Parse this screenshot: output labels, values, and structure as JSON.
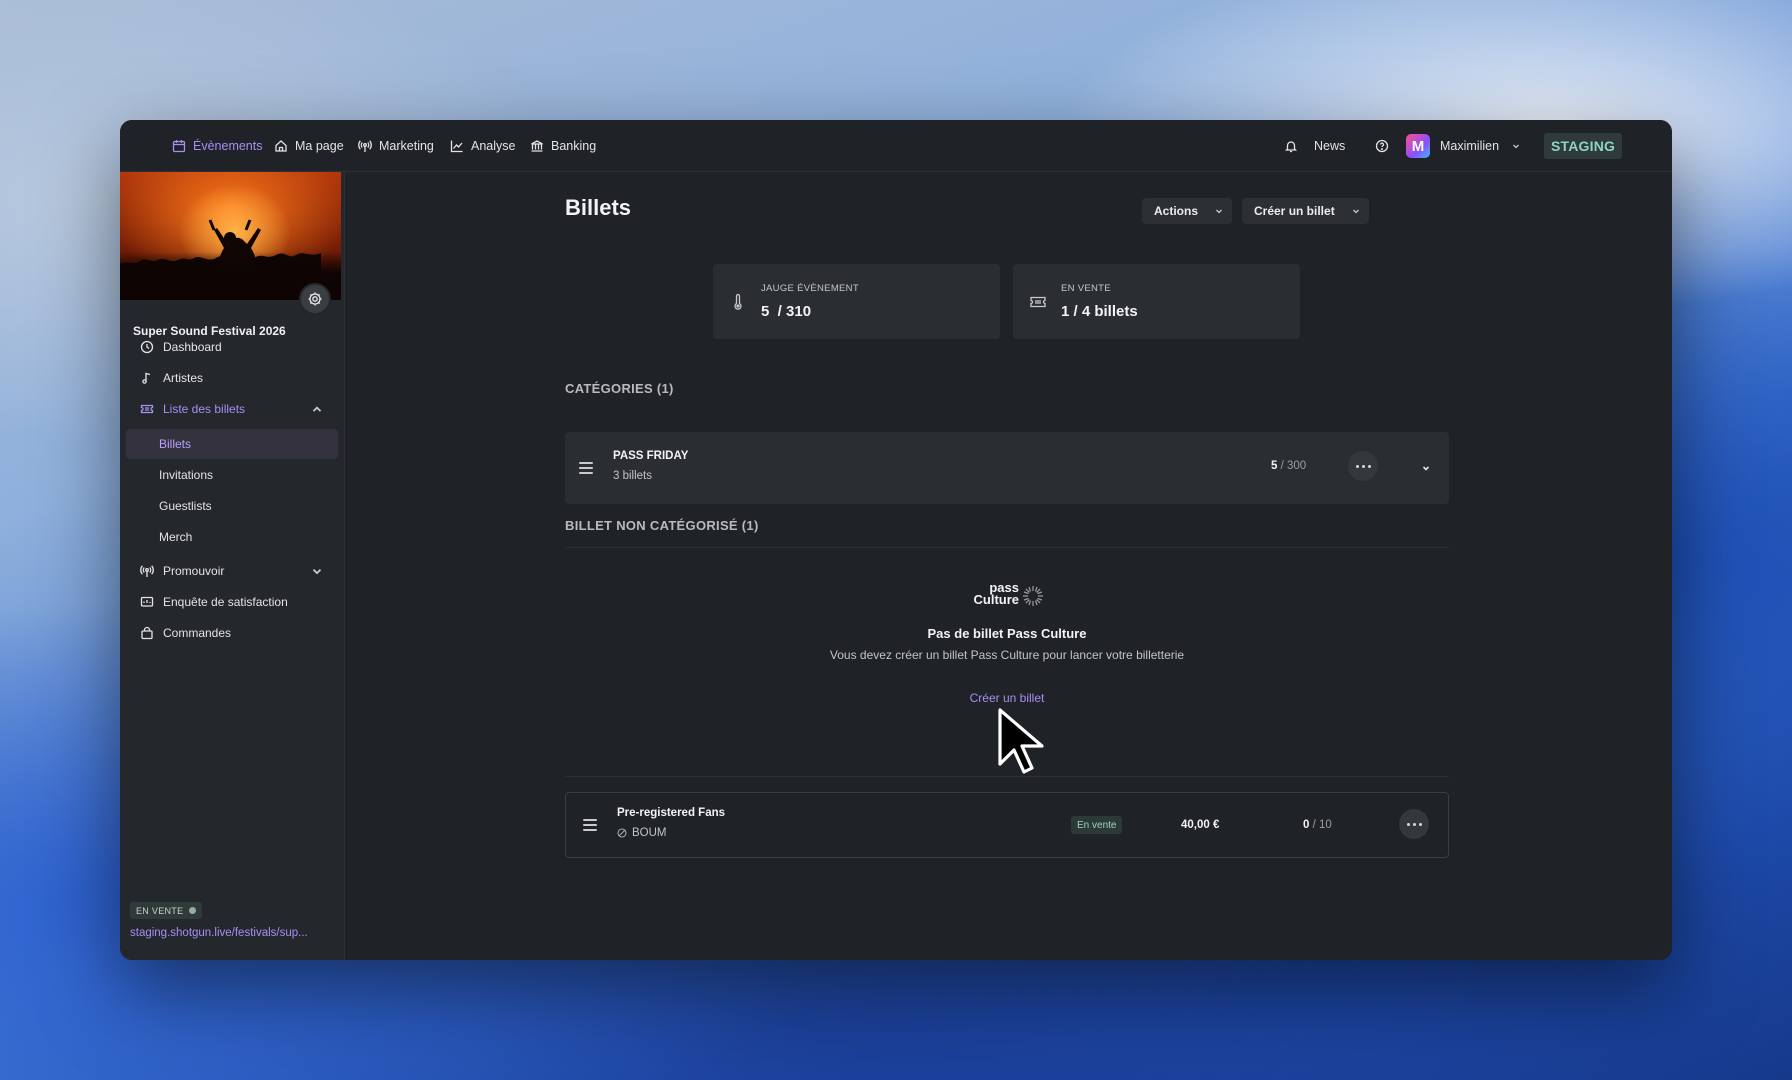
{
  "topnav": {
    "items": [
      {
        "label": "Évènements",
        "icon": "calendar-icon",
        "active": true
      },
      {
        "label": "Ma page",
        "icon": "home-icon"
      },
      {
        "label": "Marketing",
        "icon": "broadcast-icon"
      },
      {
        "label": "Analyse",
        "icon": "chart-line-icon"
      },
      {
        "label": "Banking",
        "icon": "bank-icon"
      }
    ],
    "news_label": "News",
    "user_name": "Maximilien",
    "avatar_letter": "M",
    "env_badge": "STAGING"
  },
  "sidebar": {
    "event_name": "Super Sound Festival 2026",
    "items": [
      {
        "label": "Dashboard",
        "icon": "clock-icon"
      },
      {
        "label": "Artistes",
        "icon": "music-note-icon"
      },
      {
        "label": "Liste des billets",
        "icon": "ticket-icon"
      },
      {
        "label": "Billets"
      },
      {
        "label": "Invitations"
      },
      {
        "label": "Guestlists"
      },
      {
        "label": "Merch"
      },
      {
        "label": "Promouvoir",
        "icon": "broadcast-icon"
      },
      {
        "label": "Enquête de satisfaction",
        "icon": "survey-icon"
      },
      {
        "label": "Commandes",
        "icon": "bag-icon"
      }
    ],
    "status_badge": "EN VENTE",
    "url": "staging.shotgun.live/festivals/sup..."
  },
  "main": {
    "title": "Billets",
    "actions_label": "Actions",
    "create_label": "Créer un billet",
    "stats": [
      {
        "label": "JAUGE ÉVÈNEMENT",
        "value": "5  / 310",
        "icon": "thermometer-icon"
      },
      {
        "label": "EN VENTE",
        "value": "1 / 4 billets",
        "icon": "ticket-icon"
      }
    ],
    "categories_title": "CATÉGORIES (1)",
    "category": {
      "name": "PASS FRIDAY",
      "sub": "3 billets",
      "count": "5",
      "capacity": " / 300"
    },
    "uncategorized_title": "BILLET NON CATÉGORISÉ (1)",
    "pass_culture": {
      "logo_line1": "pass",
      "logo_line2": "Culture",
      "title": "Pas de billet Pass Culture",
      "subtitle": "Vous devez créer un billet Pass Culture pour lancer votre billetterie",
      "link": "Créer un billet"
    },
    "ticket": {
      "name": "Pre-registered Fans",
      "tag": "BOUM",
      "status": "En vente",
      "price": "40,00 €",
      "sold": "0",
      "capacity": " / 10"
    }
  },
  "colors": {
    "accent": "#a98ef5",
    "window_bg": "#1f2226",
    "panel_bg": "#2a2d31",
    "env_badge": "#8fd3c4"
  }
}
